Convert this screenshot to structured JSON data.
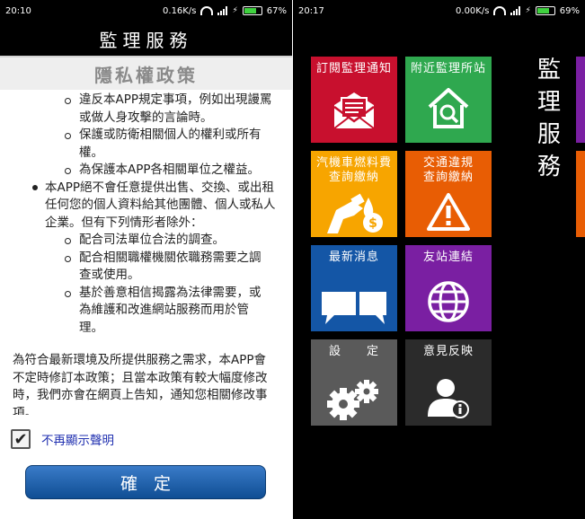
{
  "left": {
    "status": {
      "time": "20:10",
      "speed": "0.16K/s",
      "battery": "67%"
    },
    "app_title": "監理服務",
    "policy_title": "隱私權政策",
    "sub_items_top": [
      "違反本APP規定事項，例如出現謾罵或做人身攻擊的言論時。",
      "保護或防衛相關個人的權利或所有權。",
      "為保護本APP各相關單位之權益。"
    ],
    "main_item": "本APP絕不會任意提供出售、交換、或出租任何您的個人資料給其他團體、個人或私人企業。但有下列情形者除外：",
    "sub_items_bottom": [
      "配合司法單位合法的調查。",
      "配合相關職權機關依職務需要之調查或使用。",
      "基於善意相信揭露為法律需要，或為維護和改進網站服務而用於管理。"
    ],
    "paragraph": "為符合最新環境及所提供服務之需求，本APP會不定時修訂本政策；且當本政策有較大幅度修改時，我們亦會在網頁上告知，通知您相關修改事項。",
    "checkbox_label": "不再顯示聲明",
    "checkbox_checked": true,
    "confirm_label": "確定"
  },
  "right": {
    "status": {
      "time": "20:17",
      "speed": "0.00K/s",
      "battery": "69%"
    },
    "side_title": [
      "監",
      "理",
      "服",
      "務"
    ],
    "tiles": [
      {
        "label": "訂閱監理通知",
        "color": "#c8102e",
        "icon": "mail-icon"
      },
      {
        "label": "附近監理所站",
        "color": "#2fa84f",
        "icon": "home-search-icon"
      },
      {
        "label": "汽機車燃料費\n查詢繳納",
        "color": "#f7a500",
        "icon": "fuel-pump-icon"
      },
      {
        "label": "交通違規\n查詢繳納",
        "color": "#e85d04",
        "icon": "warning-icon"
      },
      {
        "label": "最新消息",
        "color": "#1456a6",
        "icon": "chat-bubbles-icon"
      },
      {
        "label": "友站連結",
        "color": "#7a1fa2",
        "icon": "globe-icon"
      },
      {
        "label": "設　　定",
        "color": "#5a5a5a",
        "icon": "gears-icon"
      },
      {
        "label": "意見反映",
        "color": "#2b2b2b",
        "icon": "user-info-icon"
      }
    ],
    "edge_colors": [
      "#7a1fa2",
      "#e85d04"
    ]
  }
}
